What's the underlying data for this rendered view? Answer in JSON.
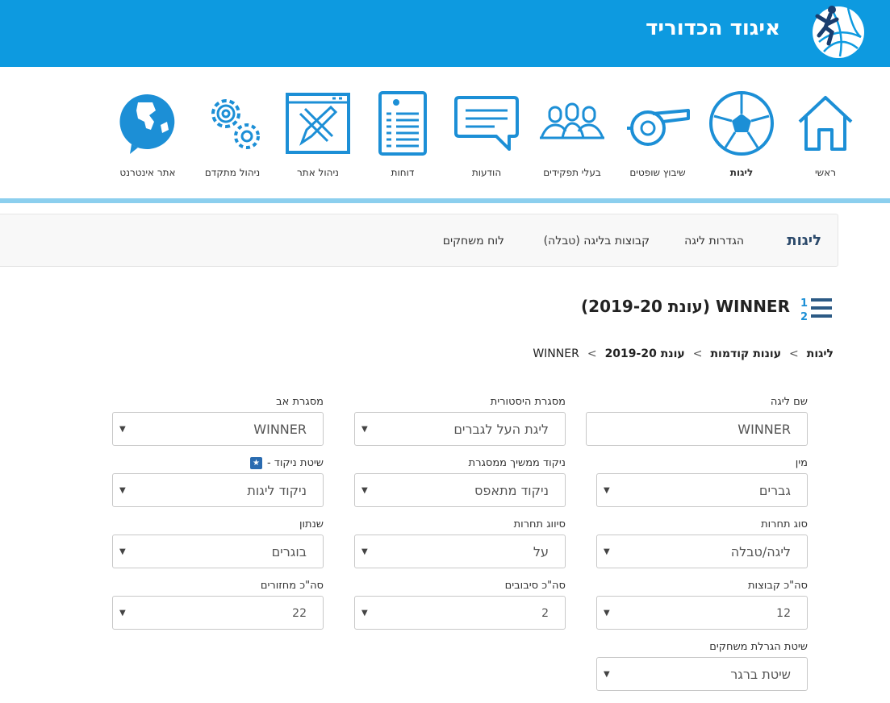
{
  "header": {
    "title": "איגוד הכדוריד"
  },
  "nav": {
    "items": [
      {
        "label": "ראשי",
        "icon": "home-icon"
      },
      {
        "label": "ליגות",
        "icon": "ball-icon",
        "active": true
      },
      {
        "label": "שיבוץ שופטים",
        "icon": "whistle-icon"
      },
      {
        "label": "בעלי תפקידים",
        "icon": "people-icon"
      },
      {
        "label": "הודעות",
        "icon": "message-icon"
      },
      {
        "label": "דוחות",
        "icon": "report-icon"
      },
      {
        "label": "ניהול אתר",
        "icon": "site-manage-icon"
      },
      {
        "label": "ניהול מתקדם",
        "icon": "gears-icon"
      },
      {
        "label": "אתר אינטרנט",
        "icon": "globe-icon"
      }
    ]
  },
  "subnav": {
    "brand": "ליגות",
    "links": [
      "הגדרות ליגה",
      "קבוצות בליגה (טבלה)",
      "לוח משחקים"
    ]
  },
  "page": {
    "title": "WINNER (עונת 2019-20)"
  },
  "breadcrumb": [
    "ליגות",
    "עונות קודמות",
    "עונת 2019-20",
    "WINNER"
  ],
  "form": {
    "league_name": {
      "label": "שם ליגה",
      "value": "WINNER"
    },
    "historic_frame": {
      "label": "מסגרת היסטורית",
      "value": "ליגת העל לגברים"
    },
    "parent_frame": {
      "label": "מסגרת אב",
      "value": "WINNER"
    },
    "gender": {
      "label": "מין",
      "value": "גברים"
    },
    "scoring_from_frame": {
      "label": "ניקוד ממשיך ממסגרת",
      "value": "ניקוד מתאפס"
    },
    "scoring_method": {
      "label": "שיטת ניקוד -",
      "value": "ניקוד ליגות"
    },
    "competition_type": {
      "label": "סוג תחרות",
      "value": "ליגה/טבלה"
    },
    "competition_class": {
      "label": "סיווג תחרות",
      "value": "על"
    },
    "age_group": {
      "label": "שנתון",
      "value": "בוגרים"
    },
    "total_teams": {
      "label": "סה\"כ קבוצות",
      "value": "12"
    },
    "total_rounds": {
      "label": "סה\"כ סיבובים",
      "value": "2"
    },
    "total_cycles": {
      "label": "סה\"כ מחזורים",
      "value": "22"
    },
    "draw_method": {
      "label": "שיטת הגרלת משחקים",
      "value": "שיטת ברגר"
    }
  },
  "colors": {
    "brand": "#0d9ae0",
    "nav_line": "#8ccfee",
    "icon_blue": "#1c8fd6"
  }
}
